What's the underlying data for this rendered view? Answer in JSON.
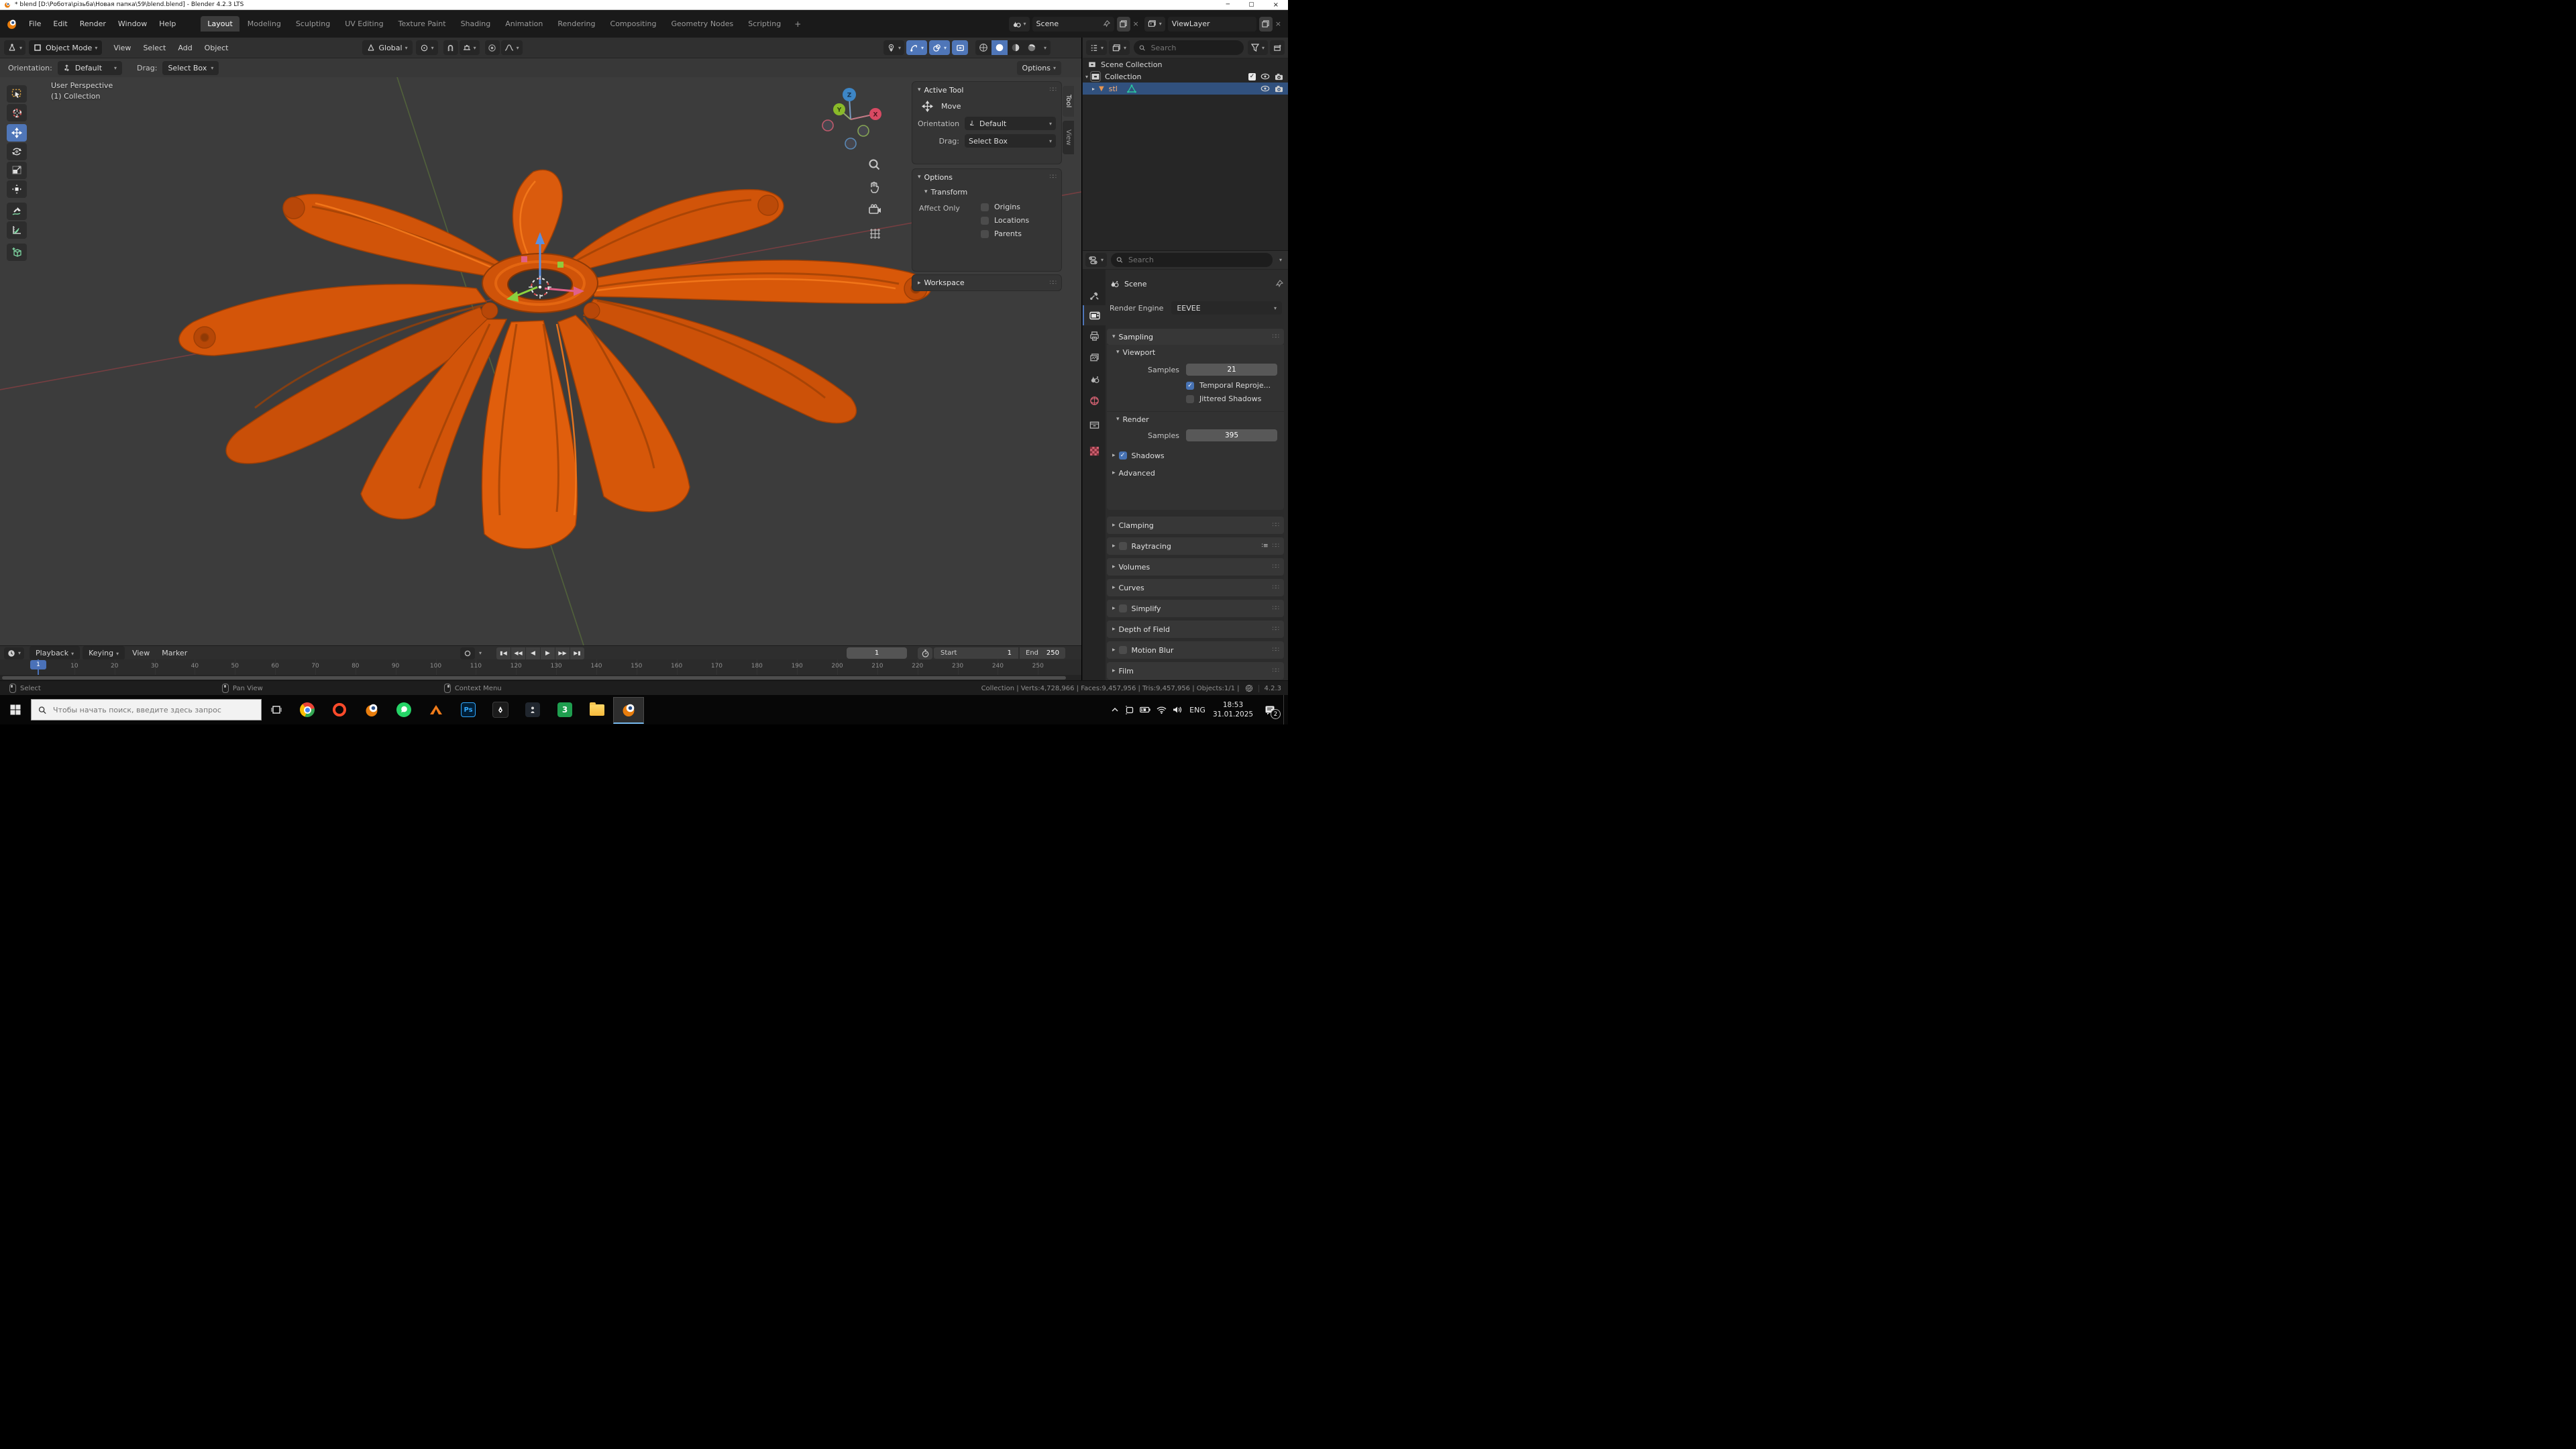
{
  "window": {
    "title": "* blend [D:\\Робота\\різьба\\Новая папка\\59\\blend.blend] - Blender 4.2.3 LTS"
  },
  "topbar": {
    "menus": [
      "File",
      "Edit",
      "Render",
      "Window",
      "Help"
    ],
    "tabs": [
      "Layout",
      "Modeling",
      "Sculpting",
      "UV Editing",
      "Texture Paint",
      "Shading",
      "Animation",
      "Rendering",
      "Compositing",
      "Geometry Nodes",
      "Scripting"
    ],
    "active_tab": "Layout",
    "add_tab": "+",
    "scene_label": "Scene",
    "viewlayer_label": "ViewLayer"
  },
  "viewport_header": {
    "mode": "Object Mode",
    "menus": [
      "View",
      "Select",
      "Add",
      "Object"
    ],
    "transform_orientation": "Global",
    "options_label": "Options"
  },
  "tool_settings": {
    "orientation_label": "Orientation:",
    "orientation_value": "Default",
    "drag_label": "Drag:",
    "drag_value": "Select Box"
  },
  "viewport": {
    "overlay_line1": "User Perspective",
    "overlay_line2": "(1) Collection",
    "axis_z": "Z",
    "axis_y": "Y",
    "axis_x": "X"
  },
  "npanel": {
    "tab_tool": "Tool",
    "tab_view": "View",
    "active_tool_title": "Active Tool",
    "tool_name": "Move",
    "orientation_label": "Orientation",
    "orientation_value": "Default",
    "drag_label": "Drag:",
    "drag_value": "Select Box",
    "options_title": "Options",
    "transform_title": "Transform",
    "affect_label": "Affect Only",
    "affect_items": [
      "Origins",
      "Locations",
      "Parents"
    ],
    "workspace_title": "Workspace"
  },
  "outliner": {
    "search_placeholder": "Search",
    "root_label": "Scene Collection",
    "collection_label": "Collection",
    "object_label": "stl"
  },
  "properties": {
    "search_placeholder": "Search",
    "breadcrumb": "Scene",
    "render_engine_label": "Render Engine",
    "render_engine_value": "EEVEE",
    "sampling_title": "Sampling",
    "viewport_title": "Viewport",
    "samples_label": "Samples",
    "viewport_samples": "21",
    "temporal_label": "Temporal Reproje...",
    "jittered_label": "Jittered Shadows",
    "render_title": "Render",
    "render_samples": "395",
    "shadows_label": "Shadows",
    "advanced_label": "Advanced",
    "collapsed_sections": [
      {
        "label": "Clamping",
        "checkbox": false,
        "list_icon": false
      },
      {
        "label": "Raytracing",
        "checkbox": true,
        "list_icon": true
      },
      {
        "label": "Volumes",
        "checkbox": false,
        "list_icon": false
      },
      {
        "label": "Curves",
        "checkbox": false,
        "list_icon": false
      },
      {
        "label": "Simplify",
        "checkbox": true,
        "list_icon": false
      },
      {
        "label": "Depth of Field",
        "checkbox": false,
        "list_icon": false
      },
      {
        "label": "Motion Blur",
        "checkbox": true,
        "list_icon": false
      },
      {
        "label": "Film",
        "checkbox": false,
        "list_icon": false
      }
    ]
  },
  "timeline": {
    "menus": [
      "Playback",
      "Keying",
      "View",
      "Marker"
    ],
    "current_frame": "1",
    "frame_field": "1",
    "start_label": "Start",
    "start_value": "1",
    "end_label": "End",
    "end_value": "250",
    "ruler_labels": [
      10,
      20,
      30,
      40,
      50,
      60,
      70,
      80,
      90,
      100,
      110,
      120,
      130,
      140,
      150,
      160,
      170,
      180,
      190,
      200,
      210,
      220,
      230,
      240,
      250
    ]
  },
  "statusbar": {
    "left_items": [
      {
        "label": "Select"
      },
      {
        "label": "Pan View"
      },
      {
        "label": "Context Menu"
      }
    ],
    "stats": [
      "Collection",
      "Verts:4,728,966",
      "Faces:9,457,956",
      "Tris:9,457,956",
      "Objects:1/1"
    ],
    "version": "4.2.3"
  },
  "taskbar": {
    "search_placeholder": "Чтобы начать поиск, введите здесь запрос",
    "lang": "ENG",
    "time": "18:53",
    "date": "31.01.2025",
    "badge": "2"
  },
  "colors": {
    "accent_blue": "#4772b3",
    "object_orange": "#d85709",
    "axis_x": "#d84a63",
    "axis_y": "#8aba29",
    "axis_z": "#3d86c6"
  }
}
